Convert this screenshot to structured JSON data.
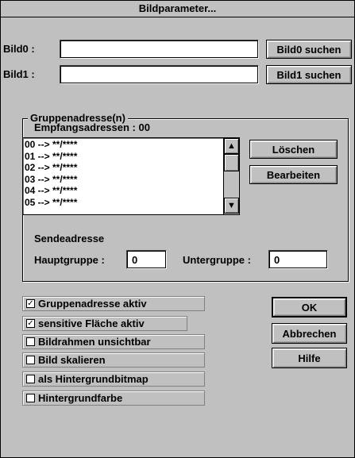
{
  "window": {
    "title": "Bildparameter..."
  },
  "bild0": {
    "label": "Bild0 :",
    "value": "",
    "search_button": "Bild0 suchen"
  },
  "bild1": {
    "label": "Bild1 :",
    "value": "",
    "search_button": "Bild1 suchen"
  },
  "group": {
    "title": "Gruppenadresse(n)",
    "empfangs_label": "Empfangsadressen : 00",
    "list_items": [
      "00 --> **/****",
      "01 --> **/****",
      "02 --> **/****",
      "03 --> **/****",
      "04 --> **/****",
      "05 --> **/****"
    ],
    "delete_button": "Löschen",
    "edit_button": "Bearbeiten",
    "sende_label": "Sendeadresse",
    "haupt_label": "Hauptgruppe :",
    "haupt_value": "0",
    "unter_label": "Untergruppe :",
    "unter_value": "0"
  },
  "options": [
    {
      "label": "Gruppenadresse aktiv",
      "checked": true
    },
    {
      "label": "sensitive Fläche aktiv",
      "checked": true
    },
    {
      "label": "Bildrahmen unsichtbar",
      "checked": false
    },
    {
      "label": "Bild skalieren",
      "checked": false
    },
    {
      "label": "als Hintergrundbitmap",
      "checked": false
    },
    {
      "label": "Hintergrundfarbe",
      "checked": false
    }
  ],
  "buttons": {
    "ok": "OK",
    "cancel": "Abbrechen",
    "help": "Hilfe"
  }
}
